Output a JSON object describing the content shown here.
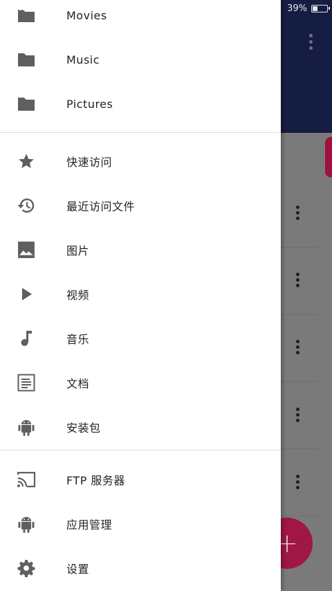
{
  "status": {
    "battery": "39%",
    "battery_level": 0.39
  },
  "drawer": {
    "bookmarks": [
      {
        "label": "Movies",
        "icon": "movie-folder-icon"
      },
      {
        "label": "Music",
        "icon": "folder-icon"
      },
      {
        "label": "Pictures",
        "icon": "folder-icon"
      }
    ],
    "categories": [
      {
        "label": "快速访问",
        "icon": "star-icon"
      },
      {
        "label": "最近访问文件",
        "icon": "history-icon"
      },
      {
        "label": "图片",
        "icon": "image-icon"
      },
      {
        "label": "视频",
        "icon": "play-icon"
      },
      {
        "label": "音乐",
        "icon": "music-note-icon"
      },
      {
        "label": "文档",
        "icon": "document-icon"
      },
      {
        "label": "安装包",
        "icon": "android-icon"
      }
    ],
    "tools": [
      {
        "label": "FTP 服务器",
        "icon": "cast-icon"
      },
      {
        "label": "应用管理",
        "icon": "android-icon"
      },
      {
        "label": "设置",
        "icon": "gear-icon"
      }
    ]
  },
  "fab": {
    "label": "+"
  },
  "colors": {
    "toolbar": "#161d42",
    "accent": "#a01745",
    "icon": "#5f5f5f"
  }
}
